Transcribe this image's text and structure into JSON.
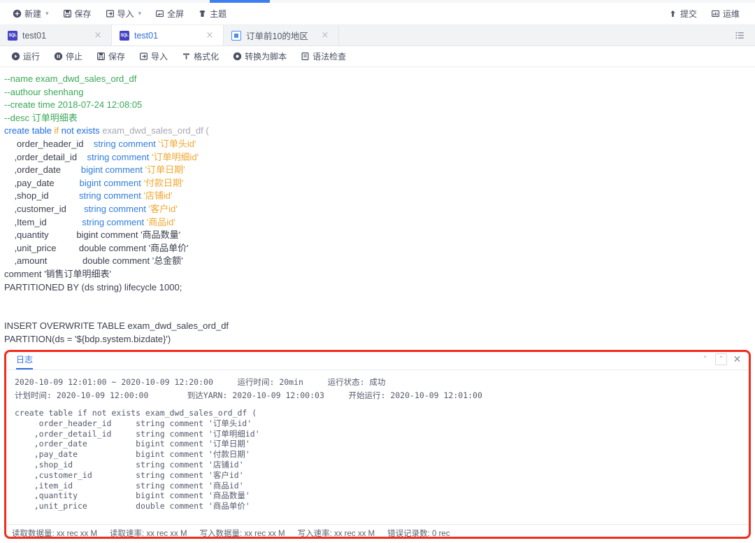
{
  "progress": {
    "percent": 8,
    "start_pct": 27.8
  },
  "main_toolbar": {
    "items": [
      {
        "label": "新建",
        "icon": "plus-circle-icon",
        "caret": true
      },
      {
        "label": "保存",
        "icon": "save-icon",
        "caret": false
      },
      {
        "label": "导入",
        "icon": "import-icon",
        "caret": true
      },
      {
        "label": "全屏",
        "icon": "fullscreen-icon",
        "caret": false
      },
      {
        "label": "主题",
        "icon": "theme-icon",
        "caret": false
      }
    ],
    "right_items": [
      {
        "label": "提交",
        "icon": "upload-arrow-icon"
      },
      {
        "label": "运维",
        "icon": "ops-monitor-icon"
      }
    ]
  },
  "tabs": {
    "items": [
      {
        "label": "test01",
        "icon": "sql-file-icon",
        "active": false,
        "close": "×"
      },
      {
        "label": "test01",
        "icon": "sql-file-icon",
        "active": true,
        "close": "×"
      },
      {
        "label": "订单前10的地区",
        "icon": "chart-file-icon",
        "active": false,
        "close": "×"
      }
    ],
    "menu_icon": "tab-list-icon"
  },
  "editor_toolbar": {
    "items": [
      {
        "label": "运行",
        "icon": "play-icon"
      },
      {
        "label": "停止",
        "icon": "pause-icon"
      },
      {
        "label": "保存",
        "icon": "save-icon"
      },
      {
        "label": "导入",
        "icon": "import-icon"
      },
      {
        "label": "格式化",
        "icon": "format-icon"
      },
      {
        "label": "转换为脚本",
        "icon": "convert-script-icon"
      },
      {
        "label": "语法检查",
        "icon": "syntax-check-icon"
      }
    ]
  },
  "editor": {
    "lines": [
      {
        "segs": [
          {
            "t": "--name exam_dwd_sales_ord_df",
            "c": "cmt"
          }
        ]
      },
      {
        "segs": [
          {
            "t": "--authour shenhang",
            "c": "cmt"
          }
        ]
      },
      {
        "segs": [
          {
            "t": "--create time 2018-07-24 12:08:05",
            "c": "cmt"
          }
        ]
      },
      {
        "segs": [
          {
            "t": "--desc 订单明细表",
            "c": "cmt"
          }
        ]
      },
      {
        "segs": [
          {
            "t": "create table ",
            "c": "kw"
          },
          {
            "t": "if",
            "c": "kw2"
          },
          {
            "t": " not exists ",
            "c": "kw"
          },
          {
            "t": "exam_dwd_sales_ord_df (",
            "c": "id"
          }
        ]
      },
      {
        "segs": [
          {
            "t": "     order_header_id    ",
            "c": "pl"
          },
          {
            "t": "string comment",
            "c": "typ"
          },
          {
            "t": " '订单头id'",
            "c": "str"
          }
        ]
      },
      {
        "segs": [
          {
            "t": "    ,order_detail_id    ",
            "c": "pl"
          },
          {
            "t": "string comment",
            "c": "typ"
          },
          {
            "t": " '订单明细id'",
            "c": "str"
          }
        ]
      },
      {
        "segs": [
          {
            "t": "    ,order_date        ",
            "c": "pl"
          },
          {
            "t": "bigint comment",
            "c": "typ"
          },
          {
            "t": " '订单日期'",
            "c": "str"
          }
        ]
      },
      {
        "segs": [
          {
            "t": "    ,pay_date          ",
            "c": "pl"
          },
          {
            "t": "bigint comment",
            "c": "typ"
          },
          {
            "t": " '付款日期'",
            "c": "str"
          }
        ]
      },
      {
        "segs": [
          {
            "t": "    ,shop_id            ",
            "c": "pl"
          },
          {
            "t": "string comment",
            "c": "typ"
          },
          {
            "t": " '店铺id'",
            "c": "str"
          }
        ]
      },
      {
        "segs": [
          {
            "t": "    ,customer_id       ",
            "c": "pl"
          },
          {
            "t": "string comment",
            "c": "typ"
          },
          {
            "t": " '客户id'",
            "c": "str"
          }
        ]
      },
      {
        "segs": [
          {
            "t": "    ,Item_id              ",
            "c": "pl"
          },
          {
            "t": "string comment",
            "c": "typ"
          },
          {
            "t": " '商品id'",
            "c": "str"
          }
        ]
      },
      {
        "segs": [
          {
            "t": "    ,quantity           bigint comment '商品数量'",
            "c": "dark"
          }
        ]
      },
      {
        "segs": [
          {
            "t": "    ,unit_price         double comment '商品单价'",
            "c": "dark"
          }
        ]
      },
      {
        "segs": [
          {
            "t": "    ,amount              double comment '总金额'",
            "c": "dark"
          }
        ]
      },
      {
        "segs": [
          {
            "t": "comment '销售订单明细表'",
            "c": "dark"
          }
        ]
      },
      {
        "segs": [
          {
            "t": "PARTITIONED BY (ds string) lifecycle 1000;",
            "c": "dark"
          }
        ]
      },
      {
        "segs": [
          {
            "t": "",
            "c": "dark"
          }
        ]
      },
      {
        "segs": [
          {
            "t": "",
            "c": "dark"
          }
        ]
      },
      {
        "segs": [
          {
            "t": "INSERT OVERWRITE TABLE exam_dwd_sales_ord_df",
            "c": "dark"
          }
        ]
      },
      {
        "segs": [
          {
            "t": "PARTITION(ds = '${bdp.system.bizdate}')",
            "c": "dark"
          }
        ]
      }
    ]
  },
  "log": {
    "tab_label": "日志",
    "controls": [
      {
        "name": "collapse-down-icon",
        "glyph": "˅"
      },
      {
        "name": "expand-up-icon",
        "glyph": "˄"
      },
      {
        "name": "close-icon",
        "glyph": "✕"
      }
    ],
    "meta_line1": "2020-10-09 12:01:00 ~ 2020-10-09 12:20:00     运行时间: 20min     运行状态: 成功",
    "meta_line2": "计划时间: 2020-10-09 12:00:00        到达YARN: 2020-10-09 12:00:03     开始运行: 2020-10-09 12:01:00",
    "body": "create table if not exists exam_dwd_sales_ord_df (\n     order_header_id     string comment '订单头id'\n    ,order_detail_id     string comment '订单明细id'\n    ,order_date          bigint comment '订单日期'\n    ,pay_date            bigint comment '付款日期'\n    ,shop_id             string comment '店铺id'\n    ,customer_id         string comment '客户id'\n    ,item_id             string comment '商品id'\n    ,quantity            bigint comment '商品数量'\n    ,unit_price          double comment '商品单价'"
  },
  "statusbar": {
    "items": [
      {
        "label": "读取数据量:",
        "value": "xx rec xx M"
      },
      {
        "label": "读取速率:",
        "value": "xx rec xx M"
      },
      {
        "label": "写入数据量:",
        "value": "xx rec xx M"
      },
      {
        "label": "写入速率:",
        "value": "xx rec xx M"
      },
      {
        "label": "错误记录数:",
        "value": "0 rec"
      }
    ]
  },
  "colors": {
    "accent_blue": "#2f6fe0",
    "progress_blue": "#3d7ef0",
    "annotation_red": "#f32b1c",
    "comment_green": "#3aa757",
    "keyword_blue": "#1f6fe0",
    "string_orange": "#f0a830",
    "tab_icon_purple": "#4343c4"
  }
}
